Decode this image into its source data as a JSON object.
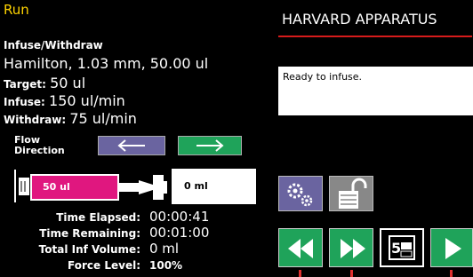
{
  "header": {
    "title": "Run",
    "brand": "HARVARD APPARATUS"
  },
  "config": {
    "mode": "Infuse/Withdraw",
    "syringe": "Hamilton, 1.03 mm, 50.00 ul",
    "target_label": "Target:",
    "target_value": "50 ul",
    "infuse_label": "Infuse:",
    "infuse_value": "150 ul/min",
    "withdraw_label": "Withdraw:",
    "withdraw_value": "75 ul/min"
  },
  "status": {
    "message": "Ready to infuse."
  },
  "flow": {
    "label_line1": "Flow",
    "label_line2": "Direction"
  },
  "syringe_visual": {
    "fill_label": "50 ul",
    "volume_label": "0 ml"
  },
  "timing": {
    "elapsed_label": "Time Elapsed:",
    "elapsed_value": "00:00:41",
    "remaining_label": "Time Remaining:",
    "remaining_value": "00:01:00",
    "total_label": "Total Inf Volume:",
    "total_value": "0 ml",
    "force_label": "Force Level:",
    "force_value": "100%"
  },
  "colors": {
    "title": "#ffd400",
    "accent_red": "#d61b1b",
    "flow_left": "#6a64a0",
    "flow_right": "#1fa35a",
    "control_green": "#1fa35a",
    "syringe_fill": "#e0177f",
    "settings": "#6a64a0"
  },
  "icons": [
    "arrow-left-icon",
    "arrow-right-icon",
    "gears-icon",
    "unlock-icon",
    "rewind-icon",
    "fast-forward-icon",
    "display-icon",
    "play-icon"
  ]
}
